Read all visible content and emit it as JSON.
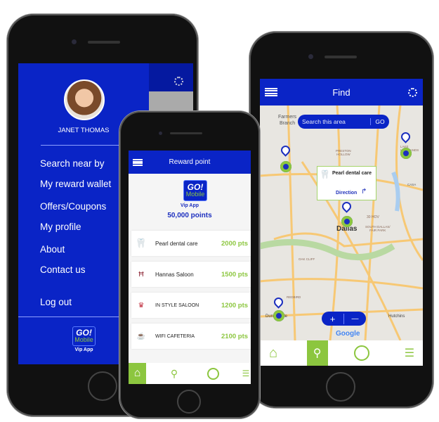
{
  "colors": {
    "brand_blue": "#0a24c6",
    "accent_green": "#8cc63f"
  },
  "left_phone": {
    "user_name": "JANET THOMAS",
    "menu": [
      {
        "label": "Search near by"
      },
      {
        "label": "My reward wallet"
      },
      {
        "label": "Offers/Coupons"
      },
      {
        "label": "My profile"
      },
      {
        "label": "About"
      },
      {
        "label": "Contact us"
      },
      {
        "label": "Log out"
      }
    ],
    "logo": {
      "top": "GO!",
      "bottom": "Mobile",
      "caption": "Vip App"
    },
    "icons": [
      "gear-icon",
      "avatar"
    ]
  },
  "middle_phone": {
    "title": "Reward point",
    "logo": {
      "top": "GO!",
      "bottom": "Mobile",
      "caption": "Vip App"
    },
    "points": "50,000 points",
    "rewards": [
      {
        "name": "Pearl dental care",
        "points": "2000 pts"
      },
      {
        "name": "Hannas Saloon",
        "points": "1500 pts"
      },
      {
        "name": "IN STYLE SALOON",
        "points": "1200 pts"
      },
      {
        "name": "WIFI CAFETERIA",
        "points": "2100 pts"
      }
    ],
    "nav": [
      "home-icon",
      "location-pin-icon",
      "user-icon",
      "sliders-icon"
    ]
  },
  "right_phone": {
    "title": "Find",
    "search_placeholder": "Search this area",
    "go_label": "GO",
    "popup": {
      "name": "Pearl dental care",
      "direction": "Direction"
    },
    "map_labels": {
      "farmers": "Farmers",
      "branch": "Branch",
      "preston": "PRESTON",
      "hollow": "HOLLOW",
      "lake": "LAKE",
      "highlands": "HIGHLANDS",
      "city": "Dallas",
      "south": "SOUTH DALLAS/",
      "fair": "FAIR PARK",
      "oak": "OAK CLIFF",
      "redbird": "REDBIRD",
      "duncanville": "Duncanville",
      "hutchins": "Hutchins",
      "hov": "30 HOV",
      "casa": "CASA"
    },
    "zoom_in": "+",
    "zoom_out": "—",
    "google": "Google",
    "nav": [
      "home-icon",
      "location-pin-icon",
      "user-icon",
      "sliders-icon"
    ],
    "active_nav": "location"
  }
}
